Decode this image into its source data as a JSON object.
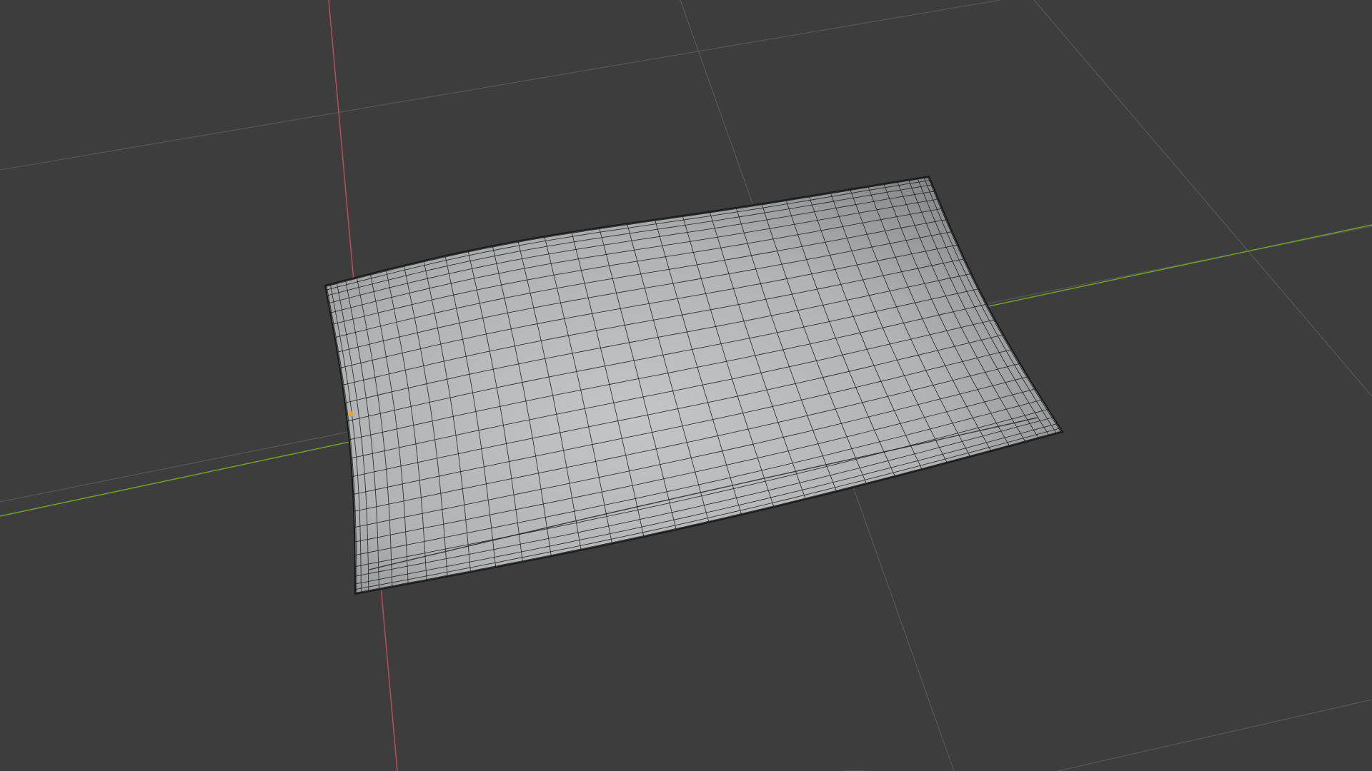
{
  "app": {
    "name": "3D viewport",
    "mode": "object-mode",
    "shading": "solid-with-wireframe-overlay"
  },
  "viewport": {
    "background_color": "#3d3d3d",
    "grid_color": "#555555",
    "x_axis_color": "#b34c55",
    "y_axis_color": "#6e9a2f",
    "grid_visible": true,
    "axes_visible": [
      "x",
      "y"
    ]
  },
  "object": {
    "type": "mesh",
    "shape": "pillow",
    "surface_color": "#b4b6b8",
    "wire_color": "#1c1c1c",
    "origin_color": "#f0a020"
  }
}
